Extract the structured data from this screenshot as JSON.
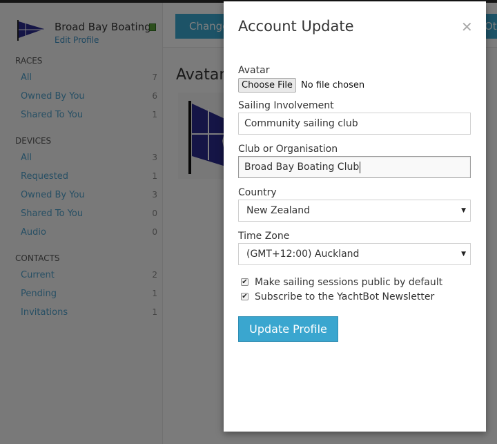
{
  "sidebar": {
    "brand_name": "Broad Bay Boating",
    "edit_profile": "Edit Profile",
    "sections": {
      "races": {
        "heading": "RACES",
        "items": [
          {
            "label": "All",
            "count": "7"
          },
          {
            "label": "Owned By You",
            "count": "6"
          },
          {
            "label": "Shared To You",
            "count": "1"
          }
        ]
      },
      "devices": {
        "heading": "DEVICES",
        "items": [
          {
            "label": "All",
            "count": "3"
          },
          {
            "label": "Requested",
            "count": "1"
          },
          {
            "label": "Owned By You",
            "count": "3"
          },
          {
            "label": "Shared To You",
            "count": "0"
          },
          {
            "label": "Audio",
            "count": "0"
          }
        ]
      },
      "contacts": {
        "heading": "CONTACTS",
        "items": [
          {
            "label": "Current",
            "count": "2"
          },
          {
            "label": "Pending",
            "count": "1"
          },
          {
            "label": "Invitations",
            "count": "1"
          }
        ]
      }
    }
  },
  "main": {
    "change_button": "Change",
    "other_button": "Ot",
    "avatar_heading": "Avatar"
  },
  "modal": {
    "title": "Account Update",
    "close_icon": "close-icon",
    "avatar_label": "Avatar",
    "file_button": "Choose File",
    "file_status": "No file chosen",
    "involvement_label": "Sailing Involvement",
    "involvement_value": "Community sailing club",
    "club_label": "Club or Organisation",
    "club_value": "Broad Bay Boating Club",
    "country_label": "Country",
    "country_value": "New Zealand",
    "timezone_label": "Time Zone",
    "timezone_value": "(GMT+12:00) Auckland",
    "checkboxes": [
      {
        "label": "Make sailing sessions public by default",
        "checked": true
      },
      {
        "label": "Subscribe to the YachtBot Newsletter",
        "checked": true
      }
    ],
    "submit_label": "Update Profile"
  },
  "colors": {
    "accent": "#3aa6cf",
    "link": "#4f9fc9",
    "flag_blue": "#2a2a8c",
    "overlay": "rgba(0,0,0,0.5)"
  }
}
